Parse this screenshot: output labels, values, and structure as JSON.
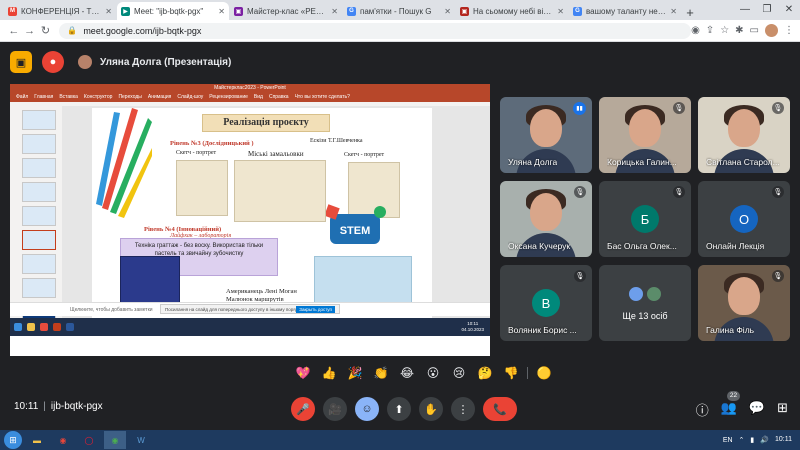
{
  "browser": {
    "tabs": [
      {
        "title": "КОНФЕРЕНЦІЯ - ТЕРН",
        "favicon_color": "#ea4335",
        "favicon_glyph": "M",
        "active": false
      },
      {
        "title": "Meet: \"ijb-bqtk-pgx\"",
        "favicon_color": "#00897b",
        "favicon_glyph": "▶",
        "active": true
      },
      {
        "title": "Майстер-клас «РЕАЛІ",
        "favicon_color": "#7b1fa2",
        "favicon_glyph": "▣",
        "active": false
      },
      {
        "title": "пам'ятки - Пошук G",
        "favicon_color": "#4285f4",
        "favicon_glyph": "G",
        "active": false
      },
      {
        "title": "На сьомому небі від п",
        "favicon_color": "#b3261e",
        "favicon_glyph": "▣",
        "active": false
      },
      {
        "title": "вашому таланту немає",
        "favicon_color": "#4285f4",
        "favicon_glyph": "G",
        "active": false
      }
    ],
    "new_tab": "+",
    "url": "meet.google.com/ijb-bqtk-pgx",
    "window_controls": [
      "—",
      "❐",
      "✕"
    ]
  },
  "meet": {
    "presenter_label": "Уляна Долга (Презентація)",
    "meeting_code": "ijb-bqtk-pgx",
    "time": "10:11",
    "participants_badge": "22",
    "more_tile_label": "Ще 13 осіб"
  },
  "slide": {
    "window_title": "Майстерклас2023 - PowerPoint",
    "ribbon_tabs": [
      "Файл",
      "Главная",
      "Вставка",
      "Конструктор",
      "Переходы",
      "Анимация",
      "Слайд-шоу",
      "Рецензирование",
      "Вид",
      "Справка",
      "Что вы хотите сделать?"
    ],
    "title": "Реалізація проєкту",
    "level3": "Рівень №3 (Дослідницький )",
    "level3_author": "Ескізи Т.Г.Шевченка",
    "sketch_label_1": "Скетч - портрет",
    "sketch_label_2": "Міські замальовки",
    "sketch_label_3": "Скетч - портрет",
    "level4": "Рівень  №4 (Інноваційний)",
    "level4_sub": "Лайфхак – лабораторія",
    "technique": "Техніка  граттаж - без  воску. Використав тільки пастель та звичайну зубочистку",
    "author_caption": "Американець Лені Моган Малюнок маршрутів подорожей",
    "stem_text": "STEM",
    "notes_placeholder": "Щелкните, чтобы добавить заметки",
    "notice_text": "Посилання на слайд для попереднього доступу в іншому порядку",
    "notice_button": "Закрыть доступ",
    "clock": "10:11",
    "date": "04.10.2023"
  },
  "tiles": [
    {
      "name": "Уляна Долга",
      "type": "video",
      "speaking": true,
      "bg": "#5d6b7a"
    },
    {
      "name": "Корицька Галин...",
      "type": "video",
      "muted": true,
      "bg": "#b6a99a"
    },
    {
      "name": "Світлана Старол...",
      "type": "video",
      "muted": true,
      "bg": "#d9d3c5"
    },
    {
      "name": "Оксана Кучерук",
      "type": "video",
      "muted": true,
      "bg": "#a8b0ad"
    },
    {
      "name": "Бас Ольга Олек...",
      "type": "letter",
      "letter": "Б",
      "muted": true,
      "color": "#00796b"
    },
    {
      "name": "Онлайн Лекція",
      "type": "letter",
      "letter": "О",
      "muted": true,
      "color": "#1565c0"
    },
    {
      "name": "Воляник Борис ...",
      "type": "letter",
      "letter": "В",
      "muted": true,
      "color": "#00897b"
    },
    {
      "name": "Ще 13 осіб",
      "type": "more"
    },
    {
      "name": "Галина Філь",
      "type": "video",
      "muted": true,
      "bg": "#6b5a4a"
    }
  ],
  "reactions": [
    "💖",
    "👍",
    "🎉",
    "👏",
    "😂",
    "😮",
    "😢",
    "🤔",
    "👎",
    "🟡"
  ],
  "controls": {
    "mic": "🎤",
    "camera": "🎥",
    "emoji": "☺",
    "present": "⬆",
    "hand": "✋",
    "more": "⋮",
    "hangup": "📞"
  },
  "right_icons": [
    "ⓘ",
    "👥",
    "💬",
    "⊞"
  ],
  "taskbar": {
    "lang": "EN",
    "clock": "10:11"
  },
  "colors": {
    "meet_bg": "#202124",
    "tile_bg": "#3c4043",
    "accent_red": "#ea4335",
    "accent_yellow": "#f9ab00",
    "ppt_red": "#b7472a"
  }
}
